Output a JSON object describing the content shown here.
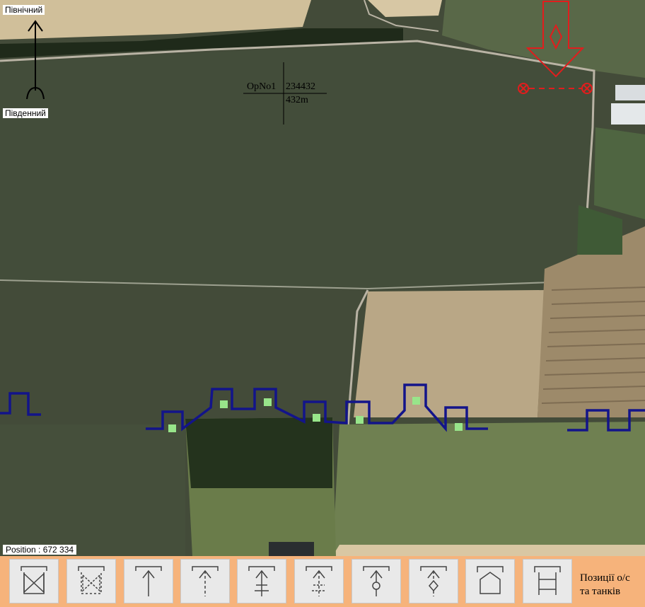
{
  "compass": {
    "north_label": "Північний",
    "south_label": "Південний"
  },
  "target_marker": {
    "label": "ОрNo1",
    "code": "234432",
    "distance": "432m"
  },
  "status": {
    "position": "Position : 672 334"
  },
  "toolbar": {
    "caption": "Позиції о/с\nта танків",
    "tools": [
      {
        "name": "tool-1",
        "icon": "bracket-bowtie-solid-icon"
      },
      {
        "name": "tool-2",
        "icon": "bracket-bowtie-dashed-icon"
      },
      {
        "name": "tool-3",
        "icon": "bracket-arrow-up-icon"
      },
      {
        "name": "tool-4",
        "icon": "bracket-arrow-up-dashed-icon"
      },
      {
        "name": "tool-5",
        "icon": "bracket-arrow-crossbars-icon"
      },
      {
        "name": "tool-6",
        "icon": "bracket-arrow-crossbars-dashed-icon"
      },
      {
        "name": "tool-7",
        "icon": "bracket-arrow-circle-icon"
      },
      {
        "name": "tool-8",
        "icon": "bracket-arrow-diamond-dashed-icon"
      },
      {
        "name": "tool-9",
        "icon": "pentagon-house-icon"
      },
      {
        "name": "tool-10",
        "icon": "bracket-double-bar-icon"
      }
    ]
  },
  "colors": {
    "field_dark": "#3f4835",
    "field_light": "#c9b28d",
    "line_blue": "#13148a",
    "marker_green": "#98e58a",
    "enemy_red": "#e11d1d",
    "toolbar_bg": "#f6b37b"
  }
}
